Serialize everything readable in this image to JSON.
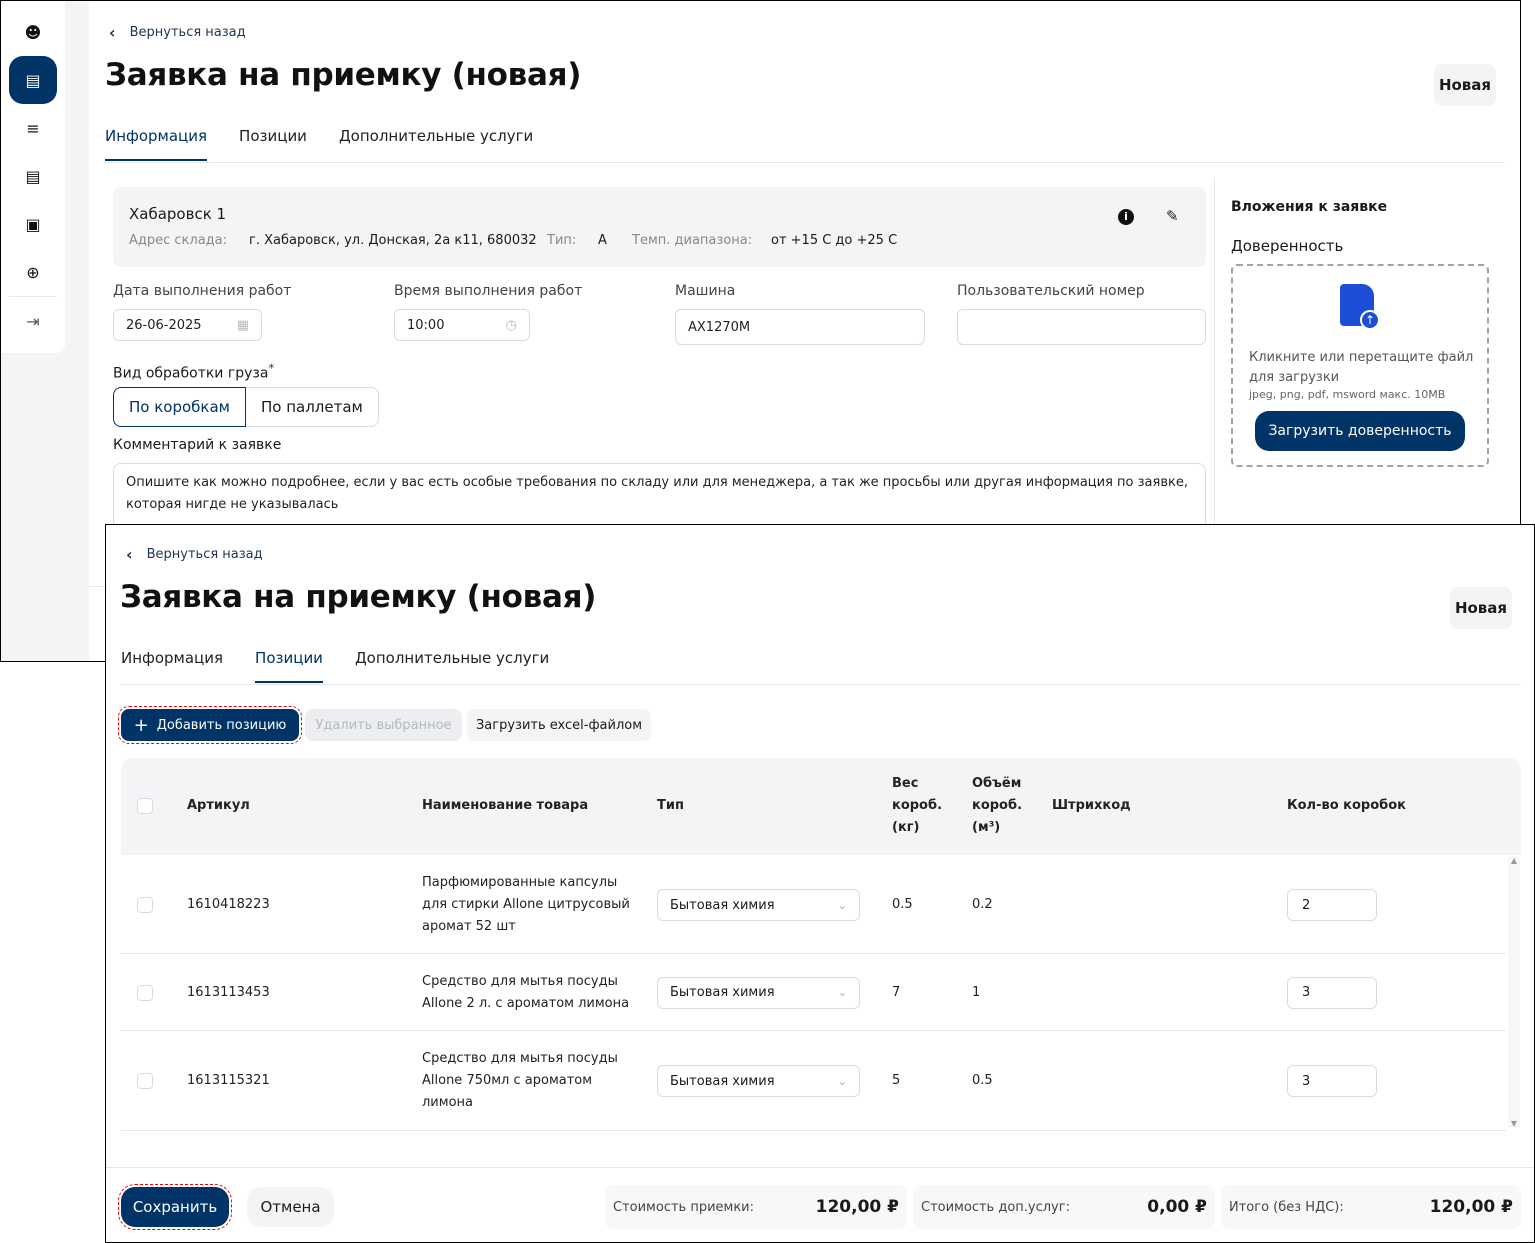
{
  "back_label": "Вернуться назад",
  "page_title": "Заявка на приемку (новая)",
  "status": "Новая",
  "tabs": [
    "Информация",
    "Позиции",
    "Дополнительные услуги"
  ],
  "sidebar": {
    "icons": [
      "user-badge-icon",
      "document-icon",
      "layers-icon",
      "file-text-icon",
      "receipt-icon",
      "plus-circle-icon"
    ],
    "collapse_icon": "collapse-right-icon"
  },
  "info": {
    "warehouse": {
      "name": "Хабаровск 1",
      "address_label": "Адрес склада:",
      "address": "г. Хабаровск, ул. Донская, 2а к11, 680032",
      "type_label": "Тип:",
      "type": "А",
      "temp_label": "Темп. диапазона:",
      "temp": "от +15 С до +25 С"
    },
    "date_label": "Дата выполнения работ",
    "date": "26-06-2025",
    "time_label": "Время выполнения работ",
    "time": "10:00",
    "car_label": "Машина",
    "car": "АХ1270М",
    "user_num_label": "Пользовательский номер",
    "user_num": "",
    "processing_label": "Вид обработки груза",
    "processing_options": [
      "По коробкам",
      "По паллетам"
    ],
    "comment_label": "Комментарий к заявке",
    "comment_placeholder": "Опишите как можно подробнее, если у вас есть особые требования по складу или для менеджера, а так же просьбы или другая информация по заявке, которая нигде не указывалась",
    "attachments_title": "Вложения к заявке",
    "poa_label": "Доверенность",
    "upload_hint": "Кликните или перетащите файл для загрузки",
    "upload_formats": "jpeg, png, pdf, msword макс. 10MB",
    "upload_button": "Загрузить доверенность"
  },
  "positions": {
    "add_button": "Добавить позицию",
    "delete_button": "Удалить выбранное",
    "excel_button": "Загрузить excel-файлом",
    "headers": [
      "Артикул",
      "Наименование товара",
      "Тип",
      "Вес короб. (кг)",
      "Объём короб. (м³)",
      "Штрихкод",
      "Кол-во коробок"
    ],
    "rows": [
      {
        "sku": "1610418223",
        "name": "Парфюмированные капсулы для стирки Allone цитрусовый аромат 52 шт",
        "type": "Бытовая химия",
        "weight": "0.5",
        "volume": "0.2",
        "barcode": "",
        "qty": "2"
      },
      {
        "sku": "1613113453",
        "name": "Средство для мытья посуды Allone 2 л. с ароматом лимона",
        "type": "Бытовая химия",
        "weight": "7",
        "volume": "1",
        "barcode": "",
        "qty": "3"
      },
      {
        "sku": "1613115321",
        "name": "Средство для мытья посуды Allone 750мл с ароматом лимона",
        "type": "Бытовая химия",
        "weight": "5",
        "volume": "0.5",
        "barcode": "",
        "qty": "3"
      }
    ]
  },
  "footer": {
    "save": "Сохранить",
    "cancel": "Отмена",
    "sums": [
      {
        "label": "Стоимость приемки:",
        "value": "120,00 ₽"
      },
      {
        "label": "Стоимость доп.услуг:",
        "value": "0,00 ₽"
      },
      {
        "label": "Итого (без НДС):",
        "value": "120,00 ₽"
      }
    ]
  },
  "colors": {
    "primary": "#003366",
    "upload_icon": "#1d4ed8"
  }
}
